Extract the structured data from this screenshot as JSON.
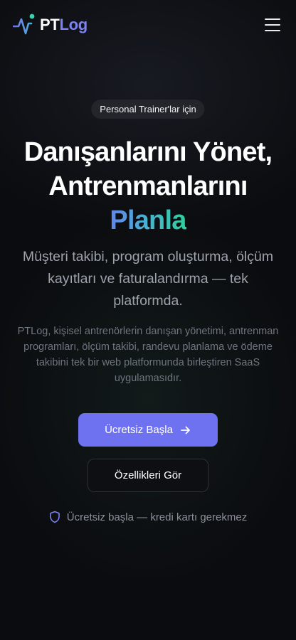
{
  "header": {
    "logo_pt": "PT",
    "logo_log": "Log",
    "menu_icon": "hamburger-menu-icon"
  },
  "hero": {
    "badge": "Personal Trainer'lar için",
    "headline_line1": "Danışanlarını Yönet,",
    "headline_line2": "Antrenmanlarını",
    "headline_accent": "Planla",
    "subtitle": "Müşteri takibi, program oluşturma, ölçüm kayıtları ve faturalandırma — tek platformda.",
    "description": "PTLog, kişisel antrenörlerin danışan yönetimi, antrenman programları, ölçüm takibi, randevu planlama ve ödeme takibini tek bir web platformunda birleştiren SaaS uygulamasıdır.",
    "primary_cta": "Ücretsiz Başla",
    "primary_cta_icon": "arrow-right-icon",
    "secondary_cta": "Özellikleri Gör",
    "note": "Ücretsiz başla — kredi kartı gerekmez",
    "note_icon": "shield-icon"
  },
  "colors": {
    "background": "#0b0c0f",
    "brand_accent": "#7b83f3",
    "primary_button": "#6f72f0",
    "gradient_start": "#5f86f0",
    "gradient_end": "#2fcf9e"
  }
}
